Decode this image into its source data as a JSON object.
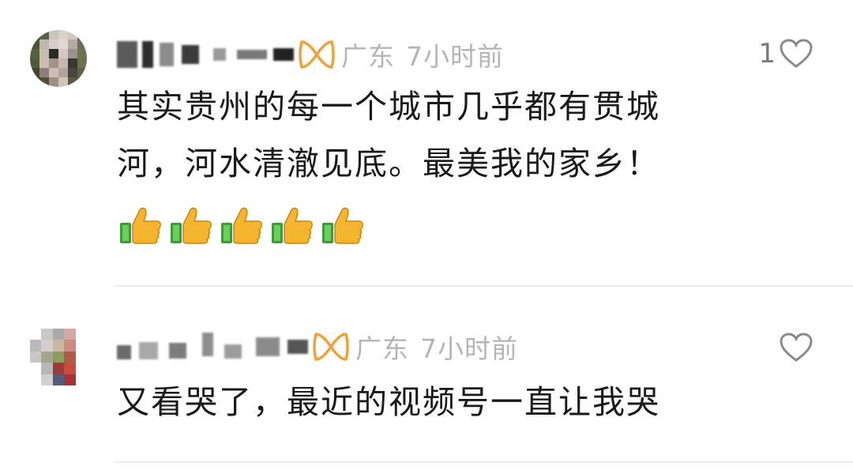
{
  "comments": [
    {
      "location": "广东",
      "time": "7小时前",
      "like_count": "1",
      "text_lines": [
        "其实贵州的每一个城市几乎都有贯城",
        "河，河水清澈见底。最美我的家乡！"
      ],
      "emoji": [
        "thumbs-up",
        "thumbs-up",
        "thumbs-up",
        "thumbs-up",
        "thumbs-up"
      ]
    },
    {
      "location": "广东",
      "time": "7小时前",
      "like_count": "",
      "text_lines": [
        "又看哭了，最近的视频号一直让我哭"
      ]
    }
  ],
  "colors": {
    "badge_orange": "#f0a13a",
    "meta_gray": "#b5b5b5",
    "text_dark": "#1a1a1a",
    "heart_outline": "#8a8a8a"
  }
}
